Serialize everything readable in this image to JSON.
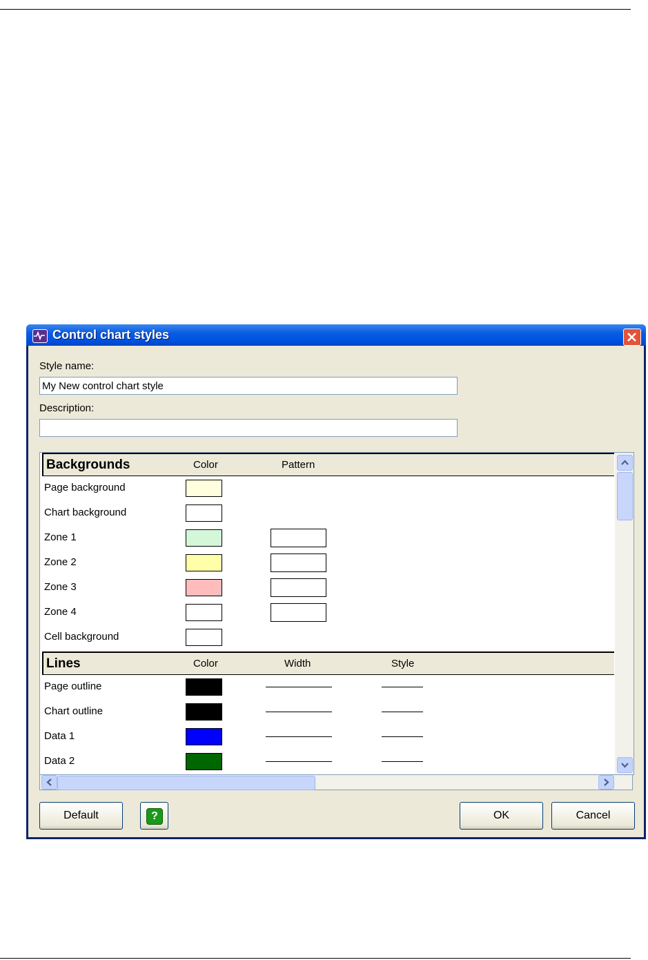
{
  "window": {
    "title": "Control chart styles",
    "app_icon": "control-chart-app-icon",
    "close_icon": "close-icon"
  },
  "form": {
    "style_name_label": "Style name:",
    "style_name_value": "My New control chart style",
    "description_label": "Description:",
    "description_value": ""
  },
  "backgrounds": {
    "title": "Backgrounds",
    "col_color": "Color",
    "col_pattern": "Pattern",
    "rows": [
      {
        "label": "Page background",
        "color": "#ffffe0",
        "has_pattern": false
      },
      {
        "label": "Chart background",
        "color": "#ffffff",
        "has_pattern": false
      },
      {
        "label": "Zone 1",
        "color": "#d4f7da",
        "has_pattern": true
      },
      {
        "label": "Zone 2",
        "color": "#ffffaa",
        "has_pattern": true
      },
      {
        "label": "Zone 3",
        "color": "#ffbcbc",
        "has_pattern": true
      },
      {
        "label": "Zone 4",
        "color": "#ffffff",
        "has_pattern": true
      },
      {
        "label": "Cell background",
        "color": "#ffffff",
        "has_pattern": false
      }
    ]
  },
  "lines": {
    "title": "Lines",
    "col_color": "Color",
    "col_width": "Width",
    "col_style": "Style",
    "rows": [
      {
        "label": "Page outline",
        "color": "#000000"
      },
      {
        "label": "Chart outline",
        "color": "#000000"
      },
      {
        "label": "Data 1",
        "color": "#0000ff"
      },
      {
        "label": "Data 2",
        "color": "#006600"
      }
    ]
  },
  "buttons": {
    "default": "Default",
    "help": "?",
    "ok": "OK",
    "cancel": "Cancel"
  }
}
